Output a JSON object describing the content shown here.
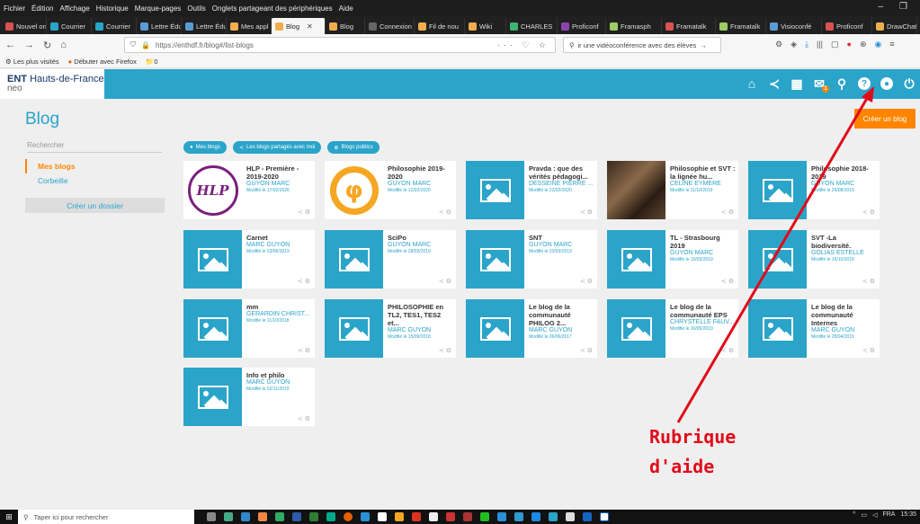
{
  "browser": {
    "menu": [
      "Fichier",
      "Édition",
      "Affichage",
      "Historique",
      "Marque-pages",
      "Outils",
      "Onglets partageant des périphériques",
      "Aide"
    ],
    "tabs": [
      {
        "label": "Nouvel on",
        "color": "#d9534f"
      },
      {
        "label": "Courrier",
        "color": "#2aa4c9"
      },
      {
        "label": "Courrier",
        "color": "#2aa4c9"
      },
      {
        "label": "Lettre Édu",
        "color": "#5a9bd4"
      },
      {
        "label": "Lettre Édu",
        "color": "#5a9bd4"
      },
      {
        "label": "Mes appl",
        "color": "#f0ad4e"
      },
      {
        "label": "Blog",
        "color": "#f0ad4e",
        "active": true
      },
      {
        "label": "Blog",
        "color": "#f0ad4e"
      },
      {
        "label": "Connexion à l",
        "color": "#666"
      },
      {
        "label": "Fil de nou",
        "color": "#f0ad4e"
      },
      {
        "label": "Wiki",
        "color": "#f0ad4e"
      },
      {
        "label": "CHARLES",
        "color": "#3cb371"
      },
      {
        "label": "Proficonf",
        "color": "#8e44ad"
      },
      {
        "label": "Framasph",
        "color": "#9ccc65"
      },
      {
        "label": "Framatalk",
        "color": "#d9534f"
      },
      {
        "label": "Framatalk",
        "color": "#9ccc65"
      },
      {
        "label": "Visioconfé",
        "color": "#5a9bd4"
      },
      {
        "label": "Proficonf",
        "color": "#d9534f"
      },
      {
        "label": "DrawChat",
        "color": "#f0ad4e"
      }
    ],
    "url": "https://enthdf.fr/blog#/list-blogs",
    "search_text": "ir une vidéoconférence avec des élèves",
    "bookmarks": [
      "Les plus visités",
      "Débuter avec Firefox",
      "0"
    ]
  },
  "ent": {
    "logo_main": "ENT",
    "logo_region": "Hauts-de-France",
    "logo_sub": "neo",
    "header_icons": [
      "home-icon",
      "share-icon",
      "apps-icon",
      "mail-icon",
      "search-icon",
      "help-icon",
      "user-icon",
      "power-icon"
    ],
    "mail_badge": "1"
  },
  "page": {
    "title": "Blog",
    "create_blog": "Créer un blog",
    "search_placeholder": "Rechercher",
    "sidebar": [
      {
        "label": "Mes blogs",
        "active": true
      },
      {
        "label": "Corbeille",
        "active": false
      }
    ],
    "create_folder": "Créer un dossier",
    "filters": [
      "Mes blogs",
      "Les blogs partagés avec moi",
      "Blogs publics"
    ]
  },
  "cards": [
    {
      "title": "HLP - Première - 2019-2020",
      "author": "GUYON MARC",
      "date": "Modifié le 17/02/2020",
      "thumb": "hlp"
    },
    {
      "title": "Philosophie 2019-2020",
      "author": "GUYON MARC",
      "date": "Modifié le 12/02/2020",
      "thumb": "phi"
    },
    {
      "title": "Pravda : que des vérités pédagogi...",
      "author": "DESSEINE PIERRE ...",
      "date": "Modifié le 22/02/2020",
      "thumb": "placeholder"
    },
    {
      "title": "Philosophie et SVT : la lignée hu...",
      "author": "CELINE EYMERE",
      "date": "Modifié le 11/10/2019",
      "thumb": "photo"
    },
    {
      "title": "Philosophie 2018-2019",
      "author": "GUYON MARC",
      "date": "Modifié le 26/08/2019",
      "thumb": "placeholder"
    },
    {
      "title": "Carnet",
      "author": "MARC GUYON",
      "date": "Modifié le 03/06/2019",
      "thumb": "placeholder"
    },
    {
      "title": "SciPo",
      "author": "GUYON MARC",
      "date": "Modifié le 28/03/2019",
      "thumb": "placeholder"
    },
    {
      "title": "SNT",
      "author": "GUYON MARC",
      "date": "Modifié le 23/03/2019",
      "thumb": "placeholder"
    },
    {
      "title": "TL - Strasbourg 2019",
      "author": "GUYON MARC",
      "date": "Modifié le 10/03/2019",
      "thumb": "placeholder"
    },
    {
      "title": "SVT -La biodiversité.",
      "author": "GOLIAS ESTELLE",
      "date": "Modifié le 16/10/2018",
      "thumb": "placeholder"
    },
    {
      "title": "mm",
      "author": "GERARDIN CHRIST...",
      "date": "Modifié le 11/10/2018",
      "thumb": "placeholder"
    },
    {
      "title": "PHILOSOPHIE en TL2, TES1, TES2 et...",
      "author": "MARC GUYON",
      "date": "Modifié le 15/09/2018",
      "thumb": "placeholder"
    },
    {
      "title": "Le blog de la communauté PHILOG 2...",
      "author": "MARC GUYON",
      "date": "Modifié le 06/06/2017",
      "thumb": "placeholder"
    },
    {
      "title": "Le blog de la communauté EPS",
      "author": "CHRYSTELLE FAUV...",
      "date": "Modifié le 30/05/2019",
      "thumb": "placeholder"
    },
    {
      "title": "Le blog de la communauté Internes",
      "author": "MARC GUYON",
      "date": "Modifié le 28/04/2019",
      "thumb": "placeholder"
    },
    {
      "title": "Info et philo",
      "author": "MARC GUYON",
      "date": "Modifié le 02/11/2019",
      "thumb": "placeholder"
    }
  ],
  "annotation": {
    "line1": "Rubrique",
    "line2": "d'aide",
    "color": "#e10a1a"
  },
  "taskbar": {
    "search_placeholder": "Taper ici pour rechercher",
    "time": "15:35",
    "lang": "FRA"
  }
}
